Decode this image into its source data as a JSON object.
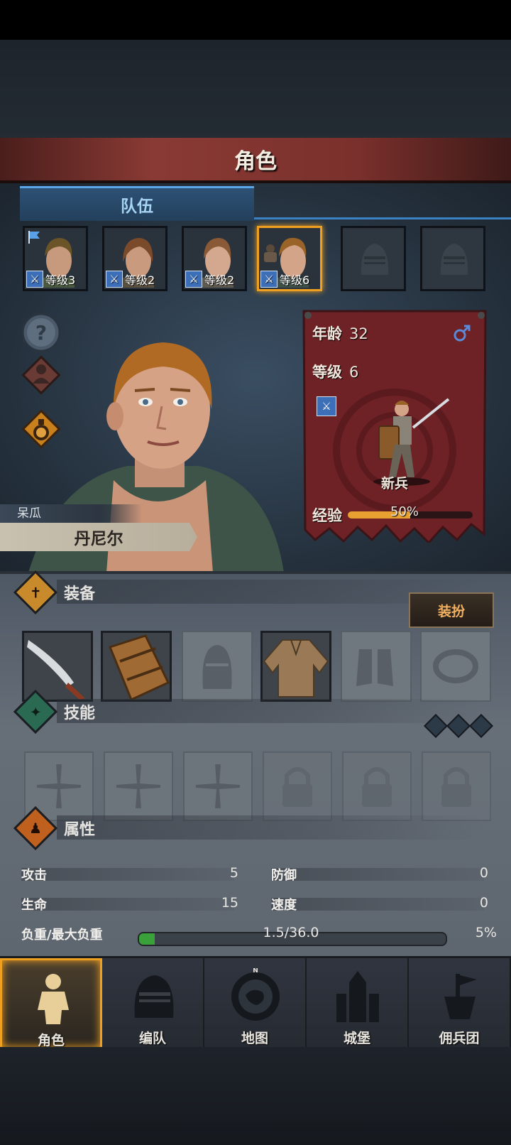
{
  "screen": {
    "title": "角色",
    "tab_team": "队伍"
  },
  "team": [
    {
      "level_label": "等级3",
      "leader": true,
      "selected": false
    },
    {
      "level_label": "等级2",
      "leader": false,
      "selected": false
    },
    {
      "level_label": "等级2",
      "leader": false,
      "selected": false
    },
    {
      "level_label": "等级6",
      "leader": false,
      "selected": true
    },
    {
      "empty": true
    },
    {
      "empty": true
    }
  ],
  "hero": {
    "nickname": "呆瓜",
    "name": "丹尼尔",
    "age_label": "年龄",
    "age": "32",
    "level_label": "等级",
    "level": "6",
    "gender_icon": "male-icon",
    "class_name": "新兵",
    "exp_label": "经验",
    "exp_percent": "50%",
    "exp_fraction": 0.5
  },
  "equipment": {
    "label": "装备",
    "dress_button": "装扮",
    "slots": [
      "sword",
      "shield",
      "helmet-empty",
      "shirt",
      "boots-empty",
      "ring-empty"
    ]
  },
  "skills": {
    "label": "技能",
    "slots": [
      "cross-empty",
      "cross-empty",
      "cross-empty",
      "locked",
      "locked",
      "locked"
    ]
  },
  "attributes": {
    "label": "属性",
    "attack_label": "攻击",
    "attack": "5",
    "defense_label": "防御",
    "defense": "0",
    "hp_label": "生命",
    "hp": "15",
    "speed_label": "速度",
    "speed": "0",
    "load_label": "负重/最大负重",
    "load_text": "1.5/36.0",
    "load_percent": "5%",
    "load_fraction": 0.05
  },
  "nav": [
    {
      "label": "角色",
      "icon": "knight-icon",
      "active": true
    },
    {
      "label": "编队",
      "icon": "helmet-icon",
      "active": false
    },
    {
      "label": "地图",
      "icon": "compass-map-icon",
      "active": false
    },
    {
      "label": "城堡",
      "icon": "castle-icon",
      "active": false
    },
    {
      "label": "佣兵团",
      "icon": "mercenary-icon",
      "active": false
    }
  ],
  "colors": {
    "accent_orange": "#f0a020",
    "tab_blue": "#3b82c4",
    "banner_red": "#6e2226"
  }
}
